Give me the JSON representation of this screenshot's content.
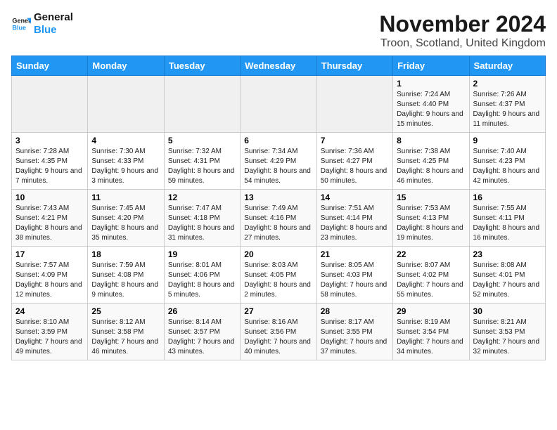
{
  "header": {
    "logo_general": "General",
    "logo_blue": "Blue",
    "month": "November 2024",
    "location": "Troon, Scotland, United Kingdom"
  },
  "weekdays": [
    "Sunday",
    "Monday",
    "Tuesday",
    "Wednesday",
    "Thursday",
    "Friday",
    "Saturday"
  ],
  "weeks": [
    [
      {
        "day": "",
        "info": ""
      },
      {
        "day": "",
        "info": ""
      },
      {
        "day": "",
        "info": ""
      },
      {
        "day": "",
        "info": ""
      },
      {
        "day": "",
        "info": ""
      },
      {
        "day": "1",
        "info": "Sunrise: 7:24 AM\nSunset: 4:40 PM\nDaylight: 9 hours and 15 minutes."
      },
      {
        "day": "2",
        "info": "Sunrise: 7:26 AM\nSunset: 4:37 PM\nDaylight: 9 hours and 11 minutes."
      }
    ],
    [
      {
        "day": "3",
        "info": "Sunrise: 7:28 AM\nSunset: 4:35 PM\nDaylight: 9 hours and 7 minutes."
      },
      {
        "day": "4",
        "info": "Sunrise: 7:30 AM\nSunset: 4:33 PM\nDaylight: 9 hours and 3 minutes."
      },
      {
        "day": "5",
        "info": "Sunrise: 7:32 AM\nSunset: 4:31 PM\nDaylight: 8 hours and 59 minutes."
      },
      {
        "day": "6",
        "info": "Sunrise: 7:34 AM\nSunset: 4:29 PM\nDaylight: 8 hours and 54 minutes."
      },
      {
        "day": "7",
        "info": "Sunrise: 7:36 AM\nSunset: 4:27 PM\nDaylight: 8 hours and 50 minutes."
      },
      {
        "day": "8",
        "info": "Sunrise: 7:38 AM\nSunset: 4:25 PM\nDaylight: 8 hours and 46 minutes."
      },
      {
        "day": "9",
        "info": "Sunrise: 7:40 AM\nSunset: 4:23 PM\nDaylight: 8 hours and 42 minutes."
      }
    ],
    [
      {
        "day": "10",
        "info": "Sunrise: 7:43 AM\nSunset: 4:21 PM\nDaylight: 8 hours and 38 minutes."
      },
      {
        "day": "11",
        "info": "Sunrise: 7:45 AM\nSunset: 4:20 PM\nDaylight: 8 hours and 35 minutes."
      },
      {
        "day": "12",
        "info": "Sunrise: 7:47 AM\nSunset: 4:18 PM\nDaylight: 8 hours and 31 minutes."
      },
      {
        "day": "13",
        "info": "Sunrise: 7:49 AM\nSunset: 4:16 PM\nDaylight: 8 hours and 27 minutes."
      },
      {
        "day": "14",
        "info": "Sunrise: 7:51 AM\nSunset: 4:14 PM\nDaylight: 8 hours and 23 minutes."
      },
      {
        "day": "15",
        "info": "Sunrise: 7:53 AM\nSunset: 4:13 PM\nDaylight: 8 hours and 19 minutes."
      },
      {
        "day": "16",
        "info": "Sunrise: 7:55 AM\nSunset: 4:11 PM\nDaylight: 8 hours and 16 minutes."
      }
    ],
    [
      {
        "day": "17",
        "info": "Sunrise: 7:57 AM\nSunset: 4:09 PM\nDaylight: 8 hours and 12 minutes."
      },
      {
        "day": "18",
        "info": "Sunrise: 7:59 AM\nSunset: 4:08 PM\nDaylight: 8 hours and 9 minutes."
      },
      {
        "day": "19",
        "info": "Sunrise: 8:01 AM\nSunset: 4:06 PM\nDaylight: 8 hours and 5 minutes."
      },
      {
        "day": "20",
        "info": "Sunrise: 8:03 AM\nSunset: 4:05 PM\nDaylight: 8 hours and 2 minutes."
      },
      {
        "day": "21",
        "info": "Sunrise: 8:05 AM\nSunset: 4:03 PM\nDaylight: 7 hours and 58 minutes."
      },
      {
        "day": "22",
        "info": "Sunrise: 8:07 AM\nSunset: 4:02 PM\nDaylight: 7 hours and 55 minutes."
      },
      {
        "day": "23",
        "info": "Sunrise: 8:08 AM\nSunset: 4:01 PM\nDaylight: 7 hours and 52 minutes."
      }
    ],
    [
      {
        "day": "24",
        "info": "Sunrise: 8:10 AM\nSunset: 3:59 PM\nDaylight: 7 hours and 49 minutes."
      },
      {
        "day": "25",
        "info": "Sunrise: 8:12 AM\nSunset: 3:58 PM\nDaylight: 7 hours and 46 minutes."
      },
      {
        "day": "26",
        "info": "Sunrise: 8:14 AM\nSunset: 3:57 PM\nDaylight: 7 hours and 43 minutes."
      },
      {
        "day": "27",
        "info": "Sunrise: 8:16 AM\nSunset: 3:56 PM\nDaylight: 7 hours and 40 minutes."
      },
      {
        "day": "28",
        "info": "Sunrise: 8:17 AM\nSunset: 3:55 PM\nDaylight: 7 hours and 37 minutes."
      },
      {
        "day": "29",
        "info": "Sunrise: 8:19 AM\nSunset: 3:54 PM\nDaylight: 7 hours and 34 minutes."
      },
      {
        "day": "30",
        "info": "Sunrise: 8:21 AM\nSunset: 3:53 PM\nDaylight: 7 hours and 32 minutes."
      }
    ]
  ]
}
